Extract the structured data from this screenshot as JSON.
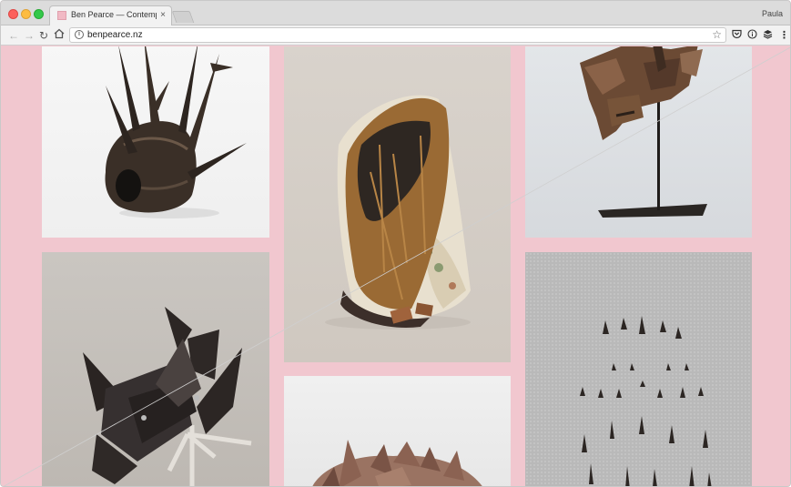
{
  "browser": {
    "tab_title": "Ben Pearce — Contemporary N",
    "profile_name": "Paula",
    "url": "benpearce.nz",
    "close_glyph": "×"
  },
  "toolbar_icons": [
    "back-arrow-icon",
    "forward-arrow-icon",
    "reload-icon",
    "home-icon",
    "info-icon",
    "star-icon",
    "pocket-icon",
    "reader-icon",
    "layers-icon",
    "menu-icon"
  ],
  "colors": {
    "page_background": "#f1c7cf"
  },
  "gallery": {
    "tiles": [
      {
        "name": "sculpture-spiky-bronze"
      },
      {
        "name": "sculpture-fibre-wrapped"
      },
      {
        "name": "sculpture-wood-on-stand"
      },
      {
        "name": "sculpture-black-folded"
      },
      {
        "name": "sculpture-wood-shards"
      },
      {
        "name": "sculpture-arrowhead-array"
      }
    ]
  }
}
